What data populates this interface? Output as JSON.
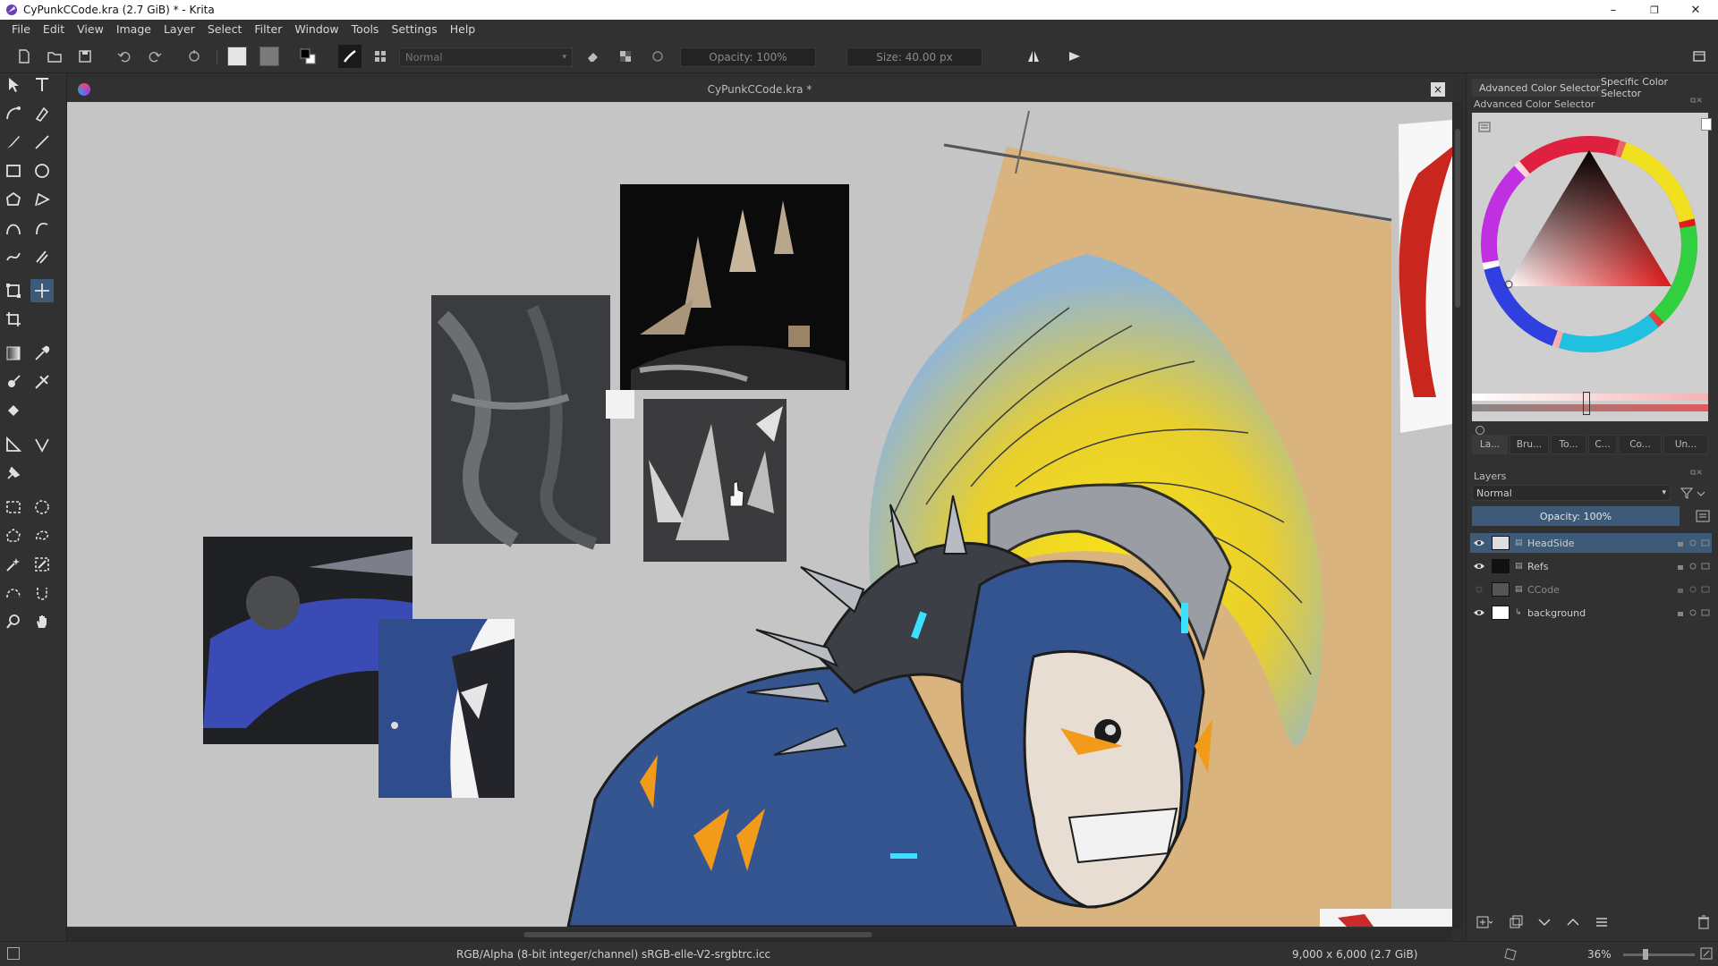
{
  "window": {
    "title": "CyPunkCCode.kra (2.7 GiB) * - Krita",
    "minimize": "–",
    "maximize": "❐",
    "close": "✕"
  },
  "menu": [
    "File",
    "Edit",
    "View",
    "Image",
    "Layer",
    "Select",
    "Filter",
    "Window",
    "Tools",
    "Settings",
    "Help"
  ],
  "toolbar": {
    "blend_mode": "Normal",
    "opacity": "Opacity: 100%",
    "size": "Size: 40.00 px"
  },
  "document": {
    "tab_title": "CyPunkCCode.kra *",
    "close": "×"
  },
  "dock": {
    "tabs": [
      "Advanced Color Selector",
      "Specific Color Selector"
    ],
    "color_panel_title": "Advanced Color Selector",
    "small_tabs": [
      "La...",
      "Bru...",
      "To...",
      "C...",
      "Co...",
      "Un..."
    ],
    "layers_title": "Layers",
    "layers_blend": "Normal",
    "layers_opacity": "Opacity:  100%",
    "layers": [
      {
        "name": "HeadSide",
        "visible": true,
        "selected": true
      },
      {
        "name": "Refs",
        "visible": true,
        "selected": false
      },
      {
        "name": "CCode",
        "visible": false,
        "selected": false
      },
      {
        "name": "background",
        "visible": true,
        "selected": false
      }
    ]
  },
  "status": {
    "color_space": "RGB/Alpha (8-bit integer/channel)  sRGB-elle-V2-srgbtrc.icc",
    "dimensions": "9,000 x 6,000 (2.7 GiB)",
    "zoom": "36%"
  },
  "colors": {
    "ui_bg": "#313131",
    "canvas_bg": "#c5c5c5",
    "selection": "#3d5a78",
    "paper": "#d9b47e",
    "armor_blue": "#34558f",
    "hair_yellow": "#f0d21e",
    "hair_blue": "#8fb3d2"
  }
}
